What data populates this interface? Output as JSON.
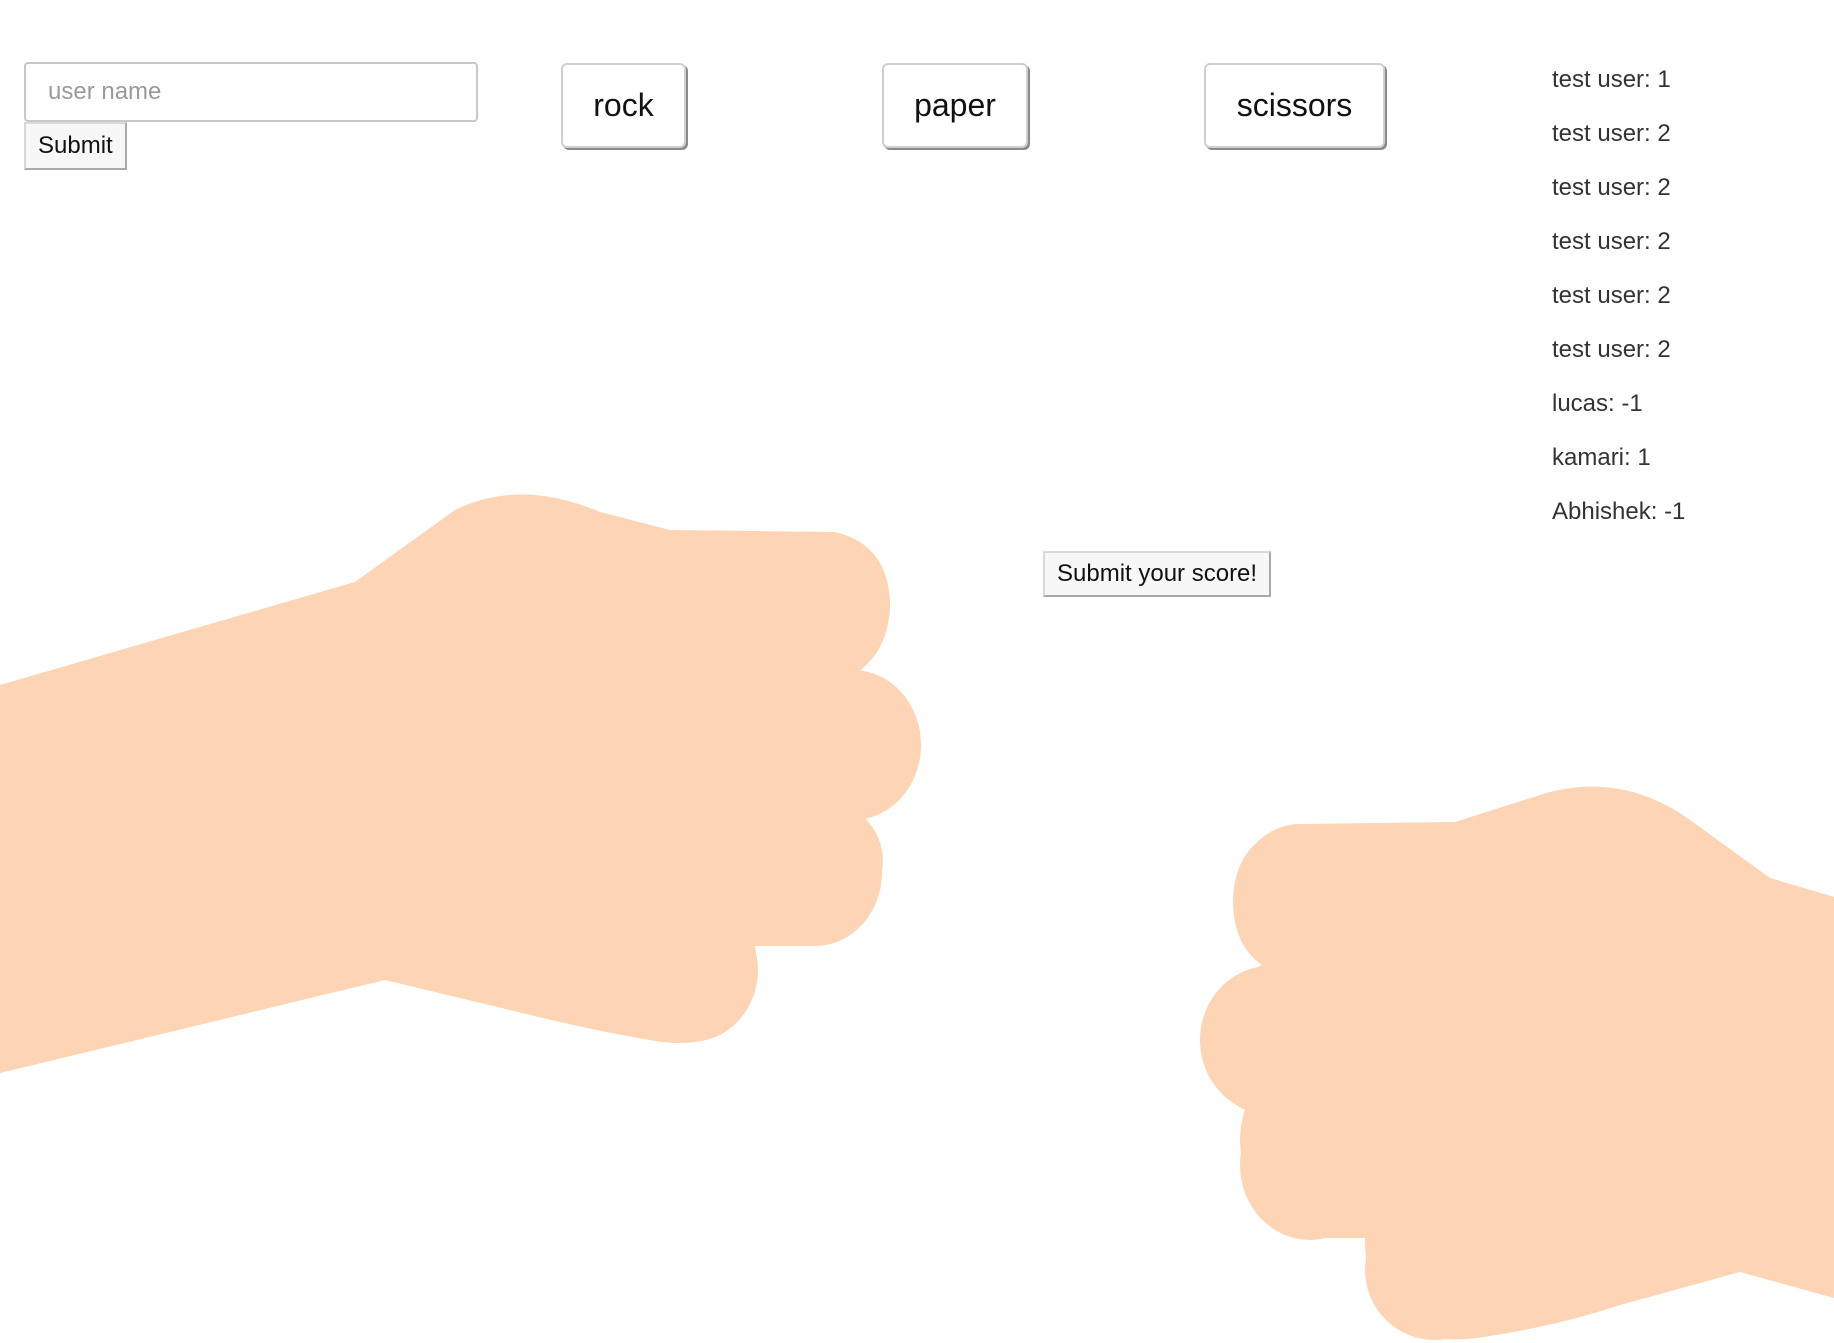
{
  "login": {
    "placeholder": "user name",
    "submit_label": "Submit"
  },
  "choices": {
    "rock": "rock",
    "paper": "paper",
    "scissors": "scissors"
  },
  "leaderboard": [
    "test user: 1",
    "test user: 2",
    "test user: 2",
    "test user: 2",
    "test user: 2",
    "test user: 2",
    "lucas: -1",
    "kamari: 1",
    "Abhishek: -1"
  ],
  "score_button_label": "Submit your score!",
  "hands": {
    "left_player_gesture": "rock",
    "right_player_gesture": "rock",
    "skin_color": "#fdd4b4"
  }
}
